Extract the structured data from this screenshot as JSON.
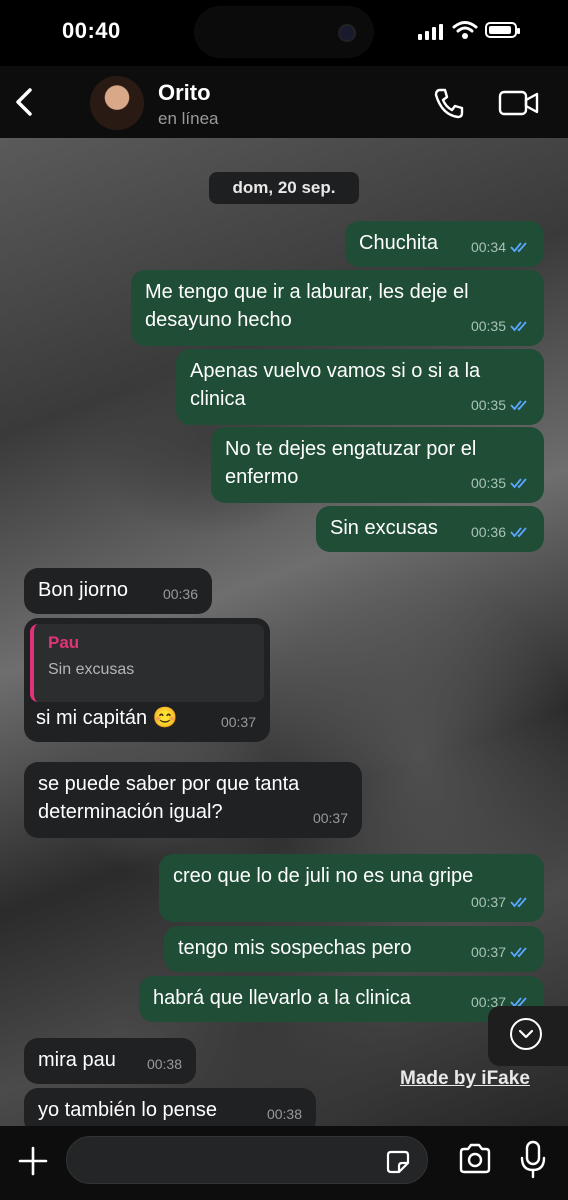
{
  "status": {
    "time": "00:40"
  },
  "header": {
    "name": "Orito",
    "status": "en línea"
  },
  "date_label": "dom, 20 sep.",
  "messages": [
    {
      "text": "Chuchita",
      "time": "00:34"
    },
    {
      "text": "Me tengo que ir a laburar, les deje el desayuno hecho",
      "time": "00:35"
    },
    {
      "text": "Apenas vuelvo vamos si o si a la clinica",
      "time": "00:35"
    },
    {
      "text": "No te dejes engatuzar por el enfermo",
      "time": "00:35"
    },
    {
      "text": "Sin excusas",
      "time": "00:36"
    },
    {
      "text": "Bon jiorno",
      "time": "00:36"
    },
    {
      "text": "si mi capitán 😊",
      "time": "00:37",
      "quote_name": "Pau",
      "quote_text": "Sin excusas"
    },
    {
      "text": "se puede saber por que tanta determinación igual?",
      "time": "00:37"
    },
    {
      "text": "creo que lo de juli no es una gripe",
      "time": "00:37"
    },
    {
      "text": "tengo mis sospechas pero",
      "time": "00:37"
    },
    {
      "text": "habrá que llevarlo a la clinica",
      "time": "00:37"
    },
    {
      "text": "mira pau",
      "time": "00:38"
    },
    {
      "text": "yo también lo pense",
      "time": "00:38"
    }
  ],
  "watermark": "Made by iFake",
  "colors": {
    "outgoing": "#1f4d36",
    "incoming": "#202123",
    "quote_accent": "#e0337a",
    "read_ticks": "#5aa7ff"
  },
  "icons": [
    "back-chevron-icon",
    "phone-icon",
    "video-camera-icon",
    "read-ticks-icon",
    "chevron-down-icon",
    "plus-icon",
    "sticker-icon",
    "camera-icon",
    "microphone-icon"
  ]
}
